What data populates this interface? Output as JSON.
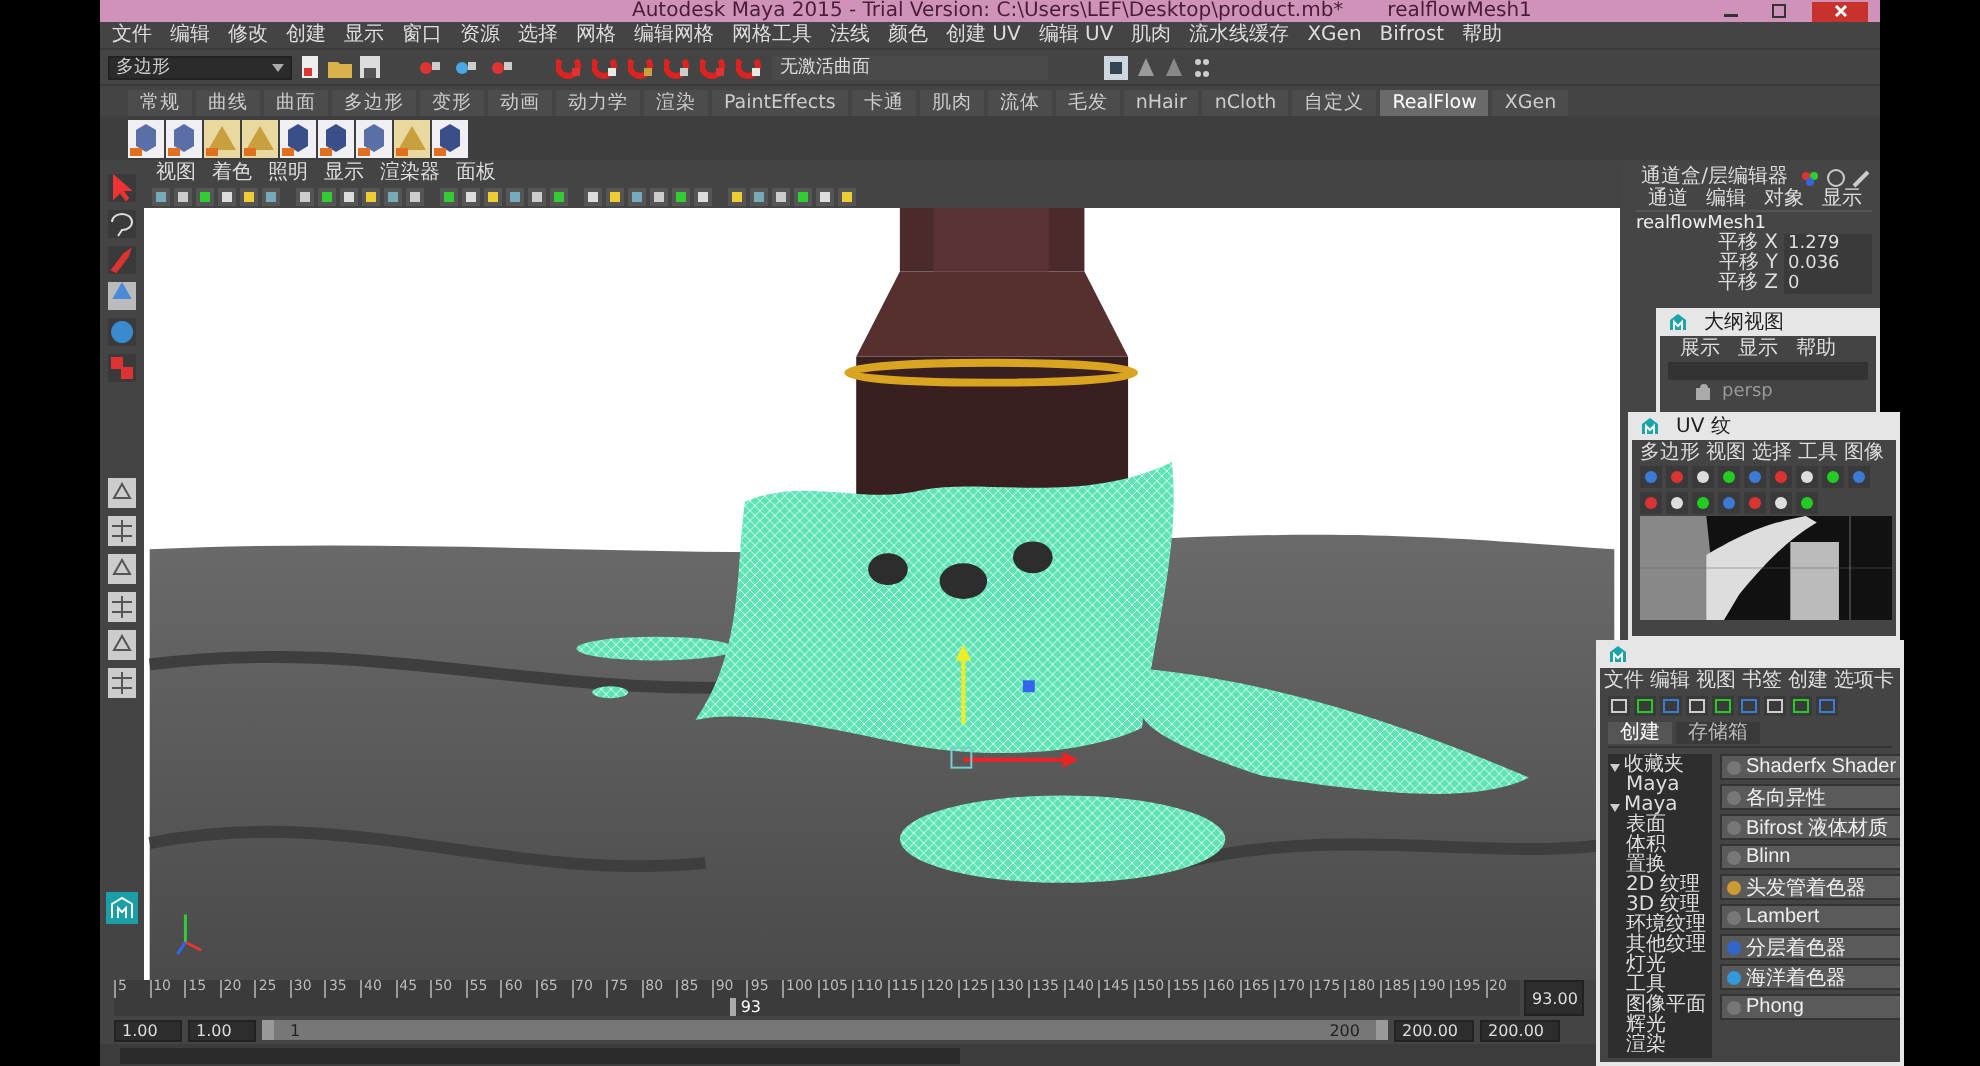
{
  "window": {
    "title": "Autodesk Maya 2015 - Trial Version: C:\\Users\\LEF\\Desktop\\product.mb*",
    "subtitle": "realflowMesh1"
  },
  "menubar": [
    "文件",
    "编辑",
    "修改",
    "创建",
    "显示",
    "窗口",
    "资源",
    "选择",
    "网格",
    "编辑网格",
    "网格工具",
    "法线",
    "颜色",
    "创建 UV",
    "编辑 UV",
    "肌肉",
    "流水线缓存",
    "XGen",
    "Bifrost",
    "帮助"
  ],
  "status_line": {
    "mode": "多边形",
    "surface": "无激活曲面"
  },
  "shelf_tabs": [
    {
      "label": "常规",
      "selected": false
    },
    {
      "label": "曲线",
      "selected": false
    },
    {
      "label": "曲面",
      "selected": false
    },
    {
      "label": "多边形",
      "selected": false
    },
    {
      "label": "变形",
      "selected": false
    },
    {
      "label": "动画",
      "selected": false
    },
    {
      "label": "动力学",
      "selected": false
    },
    {
      "label": "渲染",
      "selected": false
    },
    {
      "label": "PaintEffects",
      "selected": false
    },
    {
      "label": "卡通",
      "selected": false
    },
    {
      "label": "肌肉",
      "selected": false
    },
    {
      "label": "流体",
      "selected": false
    },
    {
      "label": "毛发",
      "selected": false
    },
    {
      "label": "nHair",
      "selected": false
    },
    {
      "label": "nCloth",
      "selected": false
    },
    {
      "label": "自定义",
      "selected": false
    },
    {
      "label": "RealFlow",
      "selected": true
    },
    {
      "label": "XGen",
      "selected": false
    }
  ],
  "panel_menu": [
    "视图",
    "着色",
    "照明",
    "显示",
    "渲染器",
    "面板"
  ],
  "channel_box": {
    "title": "通道盒/层编辑器",
    "menu": [
      "通道",
      "编辑",
      "对象",
      "显示"
    ],
    "object": "realflowMesh1",
    "attributes": [
      {
        "name": "平移 X",
        "value": "1.279"
      },
      {
        "name": "平移 Y",
        "value": "0.036"
      },
      {
        "name": "平移 Z",
        "value": "0"
      }
    ]
  },
  "outliner": {
    "title": "大纲视图",
    "menu": [
      "展示",
      "显示",
      "帮助"
    ],
    "items": [
      {
        "label": "persp"
      }
    ]
  },
  "uv_editor": {
    "title": "UV 纹",
    "menu": [
      "多边形",
      "视图",
      "选择",
      "工具",
      "图像"
    ]
  },
  "hypershade": {
    "menu": [
      "文件",
      "编辑",
      "视图",
      "书签",
      "创建",
      "选项卡"
    ],
    "tabs": [
      {
        "label": "创建",
        "selected": true
      },
      {
        "label": "存储箱",
        "selected": false
      }
    ],
    "tree": [
      {
        "label": "收藏夹",
        "expanded": true,
        "children": [
          {
            "label": "Maya"
          }
        ]
      },
      {
        "label": "Maya",
        "expanded": true,
        "children": [
          {
            "label": "表面"
          },
          {
            "label": "体积"
          },
          {
            "label": "置换"
          },
          {
            "label": "2D 纹理"
          },
          {
            "label": "3D 纹理"
          },
          {
            "label": "环境纹理"
          },
          {
            "label": "其他纹理"
          },
          {
            "label": "灯光"
          },
          {
            "label": "工具"
          },
          {
            "label": "图像平面"
          },
          {
            "label": "辉光"
          },
          {
            "label": "渲染"
          }
        ]
      }
    ],
    "materials": [
      "Shaderfx Shader",
      "各向异性",
      "Bifrost 液体材质",
      "Blinn",
      "头发管着色器",
      "Lambert",
      "分层着色器",
      "海洋着色器",
      "Phong"
    ]
  },
  "timeline": {
    "ticks": [
      "5",
      "10",
      "15",
      "20",
      "25",
      "30",
      "35",
      "40",
      "45",
      "50",
      "55",
      "60",
      "65",
      "70",
      "75",
      "80",
      "85",
      "90",
      "95",
      "100",
      "105",
      "110",
      "115",
      "120",
      "125",
      "130",
      "135",
      "140",
      "145",
      "150",
      "155",
      "160",
      "165",
      "170",
      "175",
      "180",
      "185",
      "190",
      "195",
      "20"
    ],
    "current": "93",
    "playhead": {
      "level": 0.44
    },
    "current_field": "93.00"
  },
  "range": {
    "level": 1,
    "start": "1.00",
    "playback_start": "1.00",
    "slider_start": "1",
    "slider_end": "200",
    "playback_end": "200.00",
    "end": "200.00"
  }
}
